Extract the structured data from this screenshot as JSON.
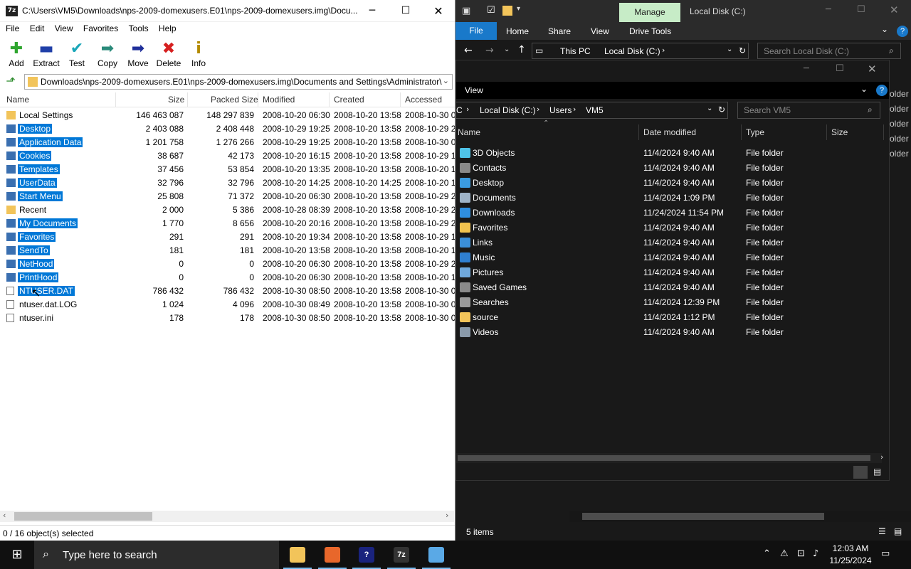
{
  "sevenzip": {
    "title": "C:\\Users\\VM5\\Downloads\\nps-2009-domexusers.E01\\nps-2009-domexusers.img\\Docu...",
    "app_icon_text": "7z",
    "menu": [
      "File",
      "Edit",
      "View",
      "Favorites",
      "Tools",
      "Help"
    ],
    "toolbar": {
      "add": "Add",
      "extract": "Extract",
      "test": "Test",
      "copy": "Copy",
      "move": "Move",
      "delete": "Delete",
      "info": "Info"
    },
    "path": "Downloads\\nps-2009-domexusers.E01\\nps-2009-domexusers.img\\Documents and Settings\\Administrator\\",
    "columns": [
      "Name",
      "Size",
      "Packed Size",
      "Modified",
      "Created",
      "Accessed"
    ],
    "rows": [
      {
        "name": "Local Settings",
        "size": "146 463 087",
        "packed": "148 297 839",
        "modified": "2008-10-20 06:30",
        "created": "2008-10-20 13:58",
        "accessed": "2008-10-30 0",
        "type": "folder",
        "selected": false
      },
      {
        "name": "Desktop",
        "size": "2 403 088",
        "packed": "2 408 448",
        "modified": "2008-10-29 19:25",
        "created": "2008-10-20 13:58",
        "accessed": "2008-10-29 2",
        "type": "folder",
        "selected": true
      },
      {
        "name": "Application Data",
        "size": "1 201 758",
        "packed": "1 276 266",
        "modified": "2008-10-29 19:25",
        "created": "2008-10-20 13:58",
        "accessed": "2008-10-30 0",
        "type": "folder",
        "selected": true
      },
      {
        "name": "Cookies",
        "size": "38 687",
        "packed": "42 173",
        "modified": "2008-10-20 16:15",
        "created": "2008-10-20 13:58",
        "accessed": "2008-10-29 1",
        "type": "folder",
        "selected": true
      },
      {
        "name": "Templates",
        "size": "37 456",
        "packed": "53 854",
        "modified": "2008-10-20 13:35",
        "created": "2008-10-20 13:58",
        "accessed": "2008-10-20 1",
        "type": "folder",
        "selected": true
      },
      {
        "name": "UserData",
        "size": "32 796",
        "packed": "32 796",
        "modified": "2008-10-20 14:25",
        "created": "2008-10-20 14:25",
        "accessed": "2008-10-20 1",
        "type": "folder",
        "selected": true
      },
      {
        "name": "Start Menu",
        "size": "25 808",
        "packed": "71 372",
        "modified": "2008-10-20 06:30",
        "created": "2008-10-20 13:58",
        "accessed": "2008-10-29 2",
        "type": "folder",
        "selected": true
      },
      {
        "name": "Recent",
        "size": "2 000",
        "packed": "5 386",
        "modified": "2008-10-28 08:39",
        "created": "2008-10-20 13:58",
        "accessed": "2008-10-29 2",
        "type": "folder",
        "selected": false
      },
      {
        "name": "My Documents",
        "size": "1 770",
        "packed": "8 656",
        "modified": "2008-10-20 20:16",
        "created": "2008-10-20 13:58",
        "accessed": "2008-10-29 2",
        "type": "folder",
        "selected": true
      },
      {
        "name": "Favorites",
        "size": "291",
        "packed": "291",
        "modified": "2008-10-20 19:34",
        "created": "2008-10-20 13:58",
        "accessed": "2008-10-29 1",
        "type": "folder",
        "selected": true
      },
      {
        "name": "SendTo",
        "size": "181",
        "packed": "181",
        "modified": "2008-10-20 13:58",
        "created": "2008-10-20 13:58",
        "accessed": "2008-10-20 1",
        "type": "folder",
        "selected": true
      },
      {
        "name": "NetHood",
        "size": "0",
        "packed": "0",
        "modified": "2008-10-20 06:30",
        "created": "2008-10-20 13:58",
        "accessed": "2008-10-29 2",
        "type": "folder",
        "selected": true
      },
      {
        "name": "PrintHood",
        "size": "0",
        "packed": "0",
        "modified": "2008-10-20 06:30",
        "created": "2008-10-20 13:58",
        "accessed": "2008-10-20 1",
        "type": "folder",
        "selected": true
      },
      {
        "name": "NTUSER.DAT",
        "size": "786 432",
        "packed": "786 432",
        "modified": "2008-10-30 08:50",
        "created": "2008-10-20 13:58",
        "accessed": "2008-10-30 0",
        "type": "file",
        "selected": true
      },
      {
        "name": "ntuser.dat.LOG",
        "size": "1 024",
        "packed": "4 096",
        "modified": "2008-10-30 08:49",
        "created": "2008-10-20 13:58",
        "accessed": "2008-10-30 0",
        "type": "file",
        "selected": false
      },
      {
        "name": "ntuser.ini",
        "size": "178",
        "packed": "178",
        "modified": "2008-10-30 08:50",
        "created": "2008-10-20 13:58",
        "accessed": "2008-10-30 0",
        "type": "file",
        "selected": false
      }
    ],
    "status": "0 / 16 object(s) selected"
  },
  "explorer": {
    "manage": "Manage",
    "title": "Local Disk (C:)",
    "ribbon": [
      "File",
      "Home",
      "Share",
      "View",
      "Drive Tools"
    ],
    "crumb": [
      "This PC",
      "Local Disk (C:)"
    ],
    "search_placeholder": "Search Local Disk (C:)",
    "status": "5 items",
    "sliver": [
      "older",
      "older",
      "older",
      "older",
      "older"
    ]
  },
  "inner": {
    "view_label": "View",
    "crumb": [
      "C",
      "Local Disk (C:)",
      "Users",
      "VM5"
    ],
    "search_placeholder": "Search VM5",
    "columns": [
      "Name",
      "Date modified",
      "Type",
      "Size"
    ],
    "rows": [
      {
        "name": "3D Objects",
        "date": "11/4/2024 9:40 AM",
        "type": "File folder",
        "icon": "cube-icon",
        "color": "#4fc3e8"
      },
      {
        "name": "Contacts",
        "date": "11/4/2024 9:40 AM",
        "type": "File folder",
        "icon": "contacts-icon",
        "color": "#8a8a8a"
      },
      {
        "name": "Desktop",
        "date": "11/4/2024 9:40 AM",
        "type": "File folder",
        "icon": "desktop-icon",
        "color": "#3b9be0"
      },
      {
        "name": "Documents",
        "date": "11/4/2024 1:09 PM",
        "type": "File folder",
        "icon": "documents-icon",
        "color": "#9fb4c8"
      },
      {
        "name": "Downloads",
        "date": "11/24/2024 11:54 PM",
        "type": "File folder",
        "icon": "download-icon",
        "color": "#2f8fe0"
      },
      {
        "name": "Favorites",
        "date": "11/4/2024 9:40 AM",
        "type": "File folder",
        "icon": "star-icon",
        "color": "#f2c34e"
      },
      {
        "name": "Links",
        "date": "11/4/2024 9:40 AM",
        "type": "File folder",
        "icon": "link-icon",
        "color": "#3b8fd8"
      },
      {
        "name": "Music",
        "date": "11/4/2024 9:40 AM",
        "type": "File folder",
        "icon": "music-icon",
        "color": "#2f7fd0"
      },
      {
        "name": "Pictures",
        "date": "11/4/2024 9:40 AM",
        "type": "File folder",
        "icon": "pictures-icon",
        "color": "#6fa8dc"
      },
      {
        "name": "Saved Games",
        "date": "11/4/2024 9:40 AM",
        "type": "File folder",
        "icon": "games-icon",
        "color": "#8a8a8a"
      },
      {
        "name": "Searches",
        "date": "11/4/2024 12:39 PM",
        "type": "File folder",
        "icon": "search-icon",
        "color": "#9a9a9a"
      },
      {
        "name": "source",
        "date": "11/4/2024 1:12 PM",
        "type": "File folder",
        "icon": "folder-icon",
        "color": "#f2c45a"
      },
      {
        "name": "Videos",
        "date": "11/4/2024 9:40 AM",
        "type": "File folder",
        "icon": "video-icon",
        "color": "#8a9aaa"
      }
    ]
  },
  "taskbar": {
    "search_placeholder": "Type here to search",
    "time": "12:03 AM",
    "date": "11/25/2024",
    "apps": [
      {
        "name": "file-explorer",
        "color": "#f2c45a",
        "label": ""
      },
      {
        "name": "firefox",
        "color": "#e8672b",
        "label": ""
      },
      {
        "name": "help",
        "color": "#1a237e",
        "label": "?"
      },
      {
        "name": "7zip",
        "color": "#333333",
        "label": "7z"
      },
      {
        "name": "notepad",
        "color": "#5aa9e6",
        "label": ""
      }
    ]
  }
}
